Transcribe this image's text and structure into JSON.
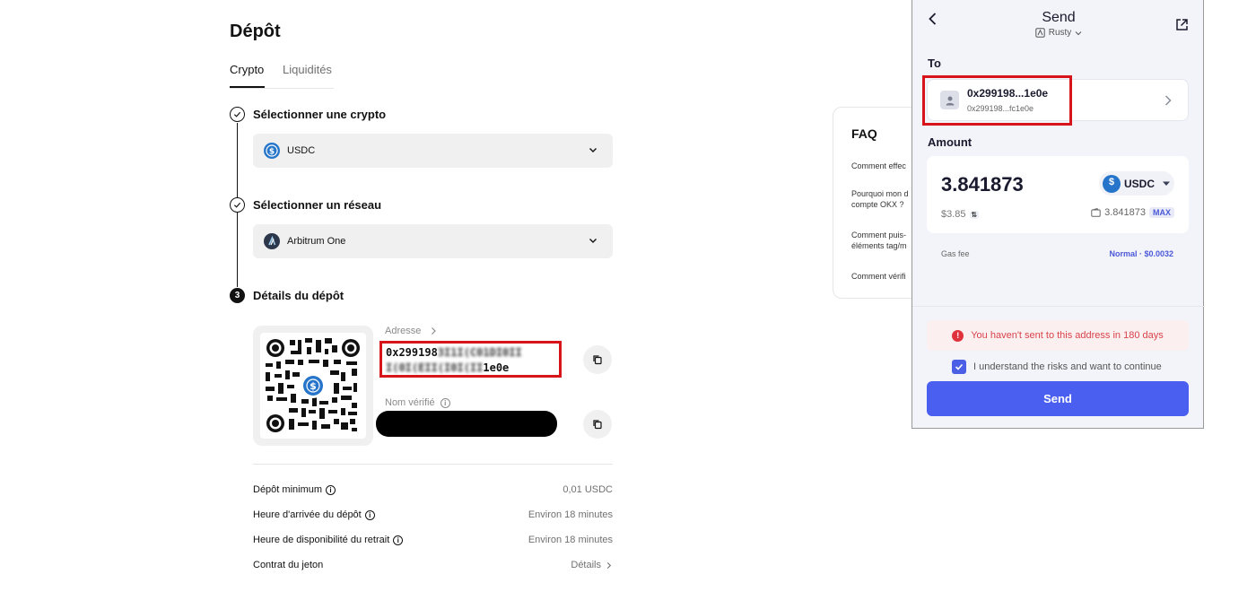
{
  "deposit": {
    "title": "Dépôt",
    "tabs": [
      {
        "label": "Crypto"
      },
      {
        "label": "Liquidités"
      }
    ],
    "steps": [
      {
        "label": "Sélectionner une crypto",
        "value": "USDC"
      },
      {
        "label": "Sélectionner un réseau",
        "value": "Arbitrum One"
      },
      {
        "number": "3",
        "label": "Détails du dépôt"
      }
    ],
    "address_label": "Adresse",
    "address_line1_start": "0x299198",
    "address_line1_blur": "3I1I(C01DI0II",
    "address_line2_blur": "I(0I(EII(I0I(II",
    "address_line2_end": "1e0e",
    "verified_name_label": "Nom vérifié",
    "details": [
      {
        "label": "Dépôt minimum",
        "value": "0,01 USDC",
        "info": true
      },
      {
        "label": "Heure d'arrivée du dépôt",
        "value": "Environ 18 minutes",
        "info": true
      },
      {
        "label": "Heure de disponibilité du retrait",
        "value": "Environ 18 minutes",
        "info": true
      },
      {
        "label": "Contrat du jeton",
        "value": "Détails",
        "info": false
      }
    ]
  },
  "faq": {
    "title": "FAQ",
    "items": [
      "Comment effec",
      "Pourquoi mon d\ncompte OKX ?",
      "Comment puis-\néléments tag/m",
      "Comment vérifi"
    ]
  },
  "wallet": {
    "title": "Send",
    "account": "Rusty",
    "to_label": "To",
    "to_address": "0x299198...1e0e",
    "to_address_full": "0x299198...fc1e0e",
    "amount_label": "Amount",
    "amount": "3.841873",
    "amount_usd": "$3.85",
    "token": "USDC",
    "balance": "3.841873",
    "max_label": "MAX",
    "gas_label": "Gas fee",
    "gas_value": "Normal · $0.0032",
    "warning": "You haven't sent to this address in 180 days",
    "confirm_text": "I understand the risks and want to continue",
    "send_label": "Send"
  },
  "colors": {
    "usdc": "#2775ca",
    "highlight": "#d8141b",
    "primary": "#4a5ff0"
  }
}
